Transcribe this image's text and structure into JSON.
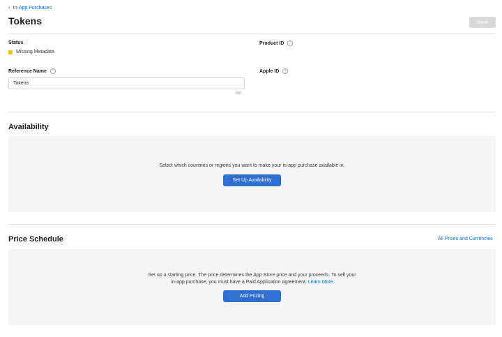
{
  "breadcrumb": {
    "label": "In-App Purchases"
  },
  "header": {
    "title": "Tokens",
    "save_label": "Save"
  },
  "fields": {
    "status": {
      "label": "Status",
      "value": "Missing Metadata",
      "color": "#f5c518"
    },
    "product_id": {
      "label": "Product ID"
    },
    "reference_name": {
      "label": "Reference Name",
      "value": "Tokens",
      "char_count": "0/0"
    },
    "apple_id": {
      "label": "Apple ID"
    }
  },
  "availability": {
    "title": "Availability",
    "description": "Select which countries or regions you want to make your in-app purchase available in.",
    "button_label": "Set Up Availability"
  },
  "price_schedule": {
    "title": "Price Schedule",
    "link_label": "All Prices and Currencies",
    "description_line1": "Set up a starting price. The price determines the App Store price and your proceeds. To sell your",
    "description_line2": "in-app purchase, you must have a Paid Application agreement.",
    "learn_more": "Learn More",
    "button_label": "Add Pricing"
  },
  "colors": {
    "accent": "#2f6fcf",
    "link": "#0a6ee8",
    "panel": "#f5f5f7"
  }
}
